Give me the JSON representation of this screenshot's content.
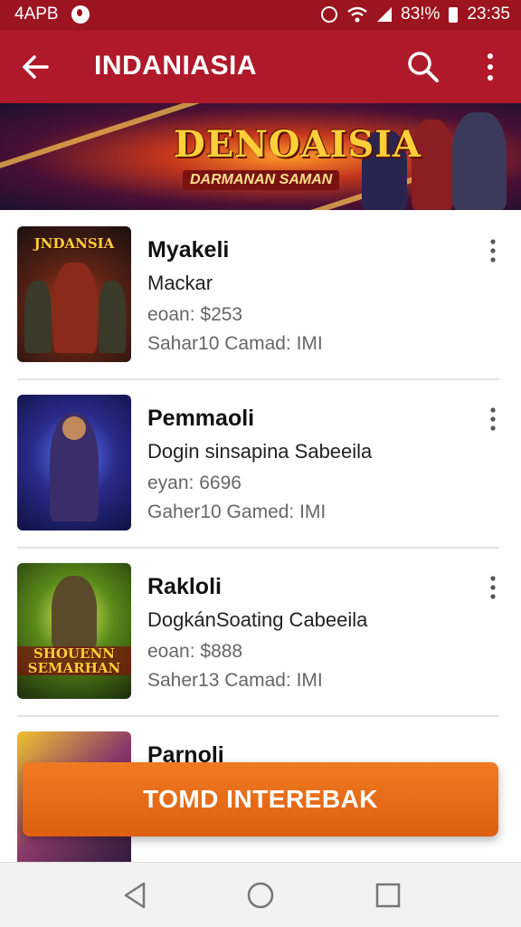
{
  "status_bar": {
    "left_text": "4APB",
    "battery_text": "83!%",
    "time": "23:35",
    "icons": [
      "app-badge-icon",
      "alarm-icon",
      "wifi-icon",
      "signal-icon",
      "battery-icon"
    ]
  },
  "app_bar": {
    "title": "INDANIASIA",
    "icons": [
      "back-arrow-icon",
      "search-icon",
      "more-vert-icon"
    ],
    "color": "#b0192a"
  },
  "banner": {
    "title": "DENOAISIA",
    "subtitle": "DARMANAN SAMAN"
  },
  "games": [
    {
      "thumb_text": "JNDANSIA",
      "name": "Myakeli",
      "subtitle": "Mackar",
      "price": "eoan: $253",
      "meta": "Sahar10 Camad: IMI"
    },
    {
      "thumb_text": "",
      "name": "Pemmaoli",
      "subtitle": "Dogin sinsapina Sabeeila",
      "price": "eyan: 6696",
      "meta": "Gaher10 Gamed: IMI"
    },
    {
      "thumb_text": "SHOUENN SEMARHAN",
      "name": "Rakloli",
      "subtitle": "DogkánSoating Cabeeila",
      "price": "eoan: $888",
      "meta": "Saher13 Camad: IMI"
    },
    {
      "thumb_text": "",
      "name": "Parnoli",
      "subtitle": "",
      "price": "",
      "meta": ""
    }
  ],
  "cta": {
    "label": "TOMD INTEREBAK",
    "color": "#e8691a"
  },
  "nav_bar": {
    "icons": [
      "back-triangle-icon",
      "home-circle-icon",
      "recents-square-icon"
    ]
  }
}
